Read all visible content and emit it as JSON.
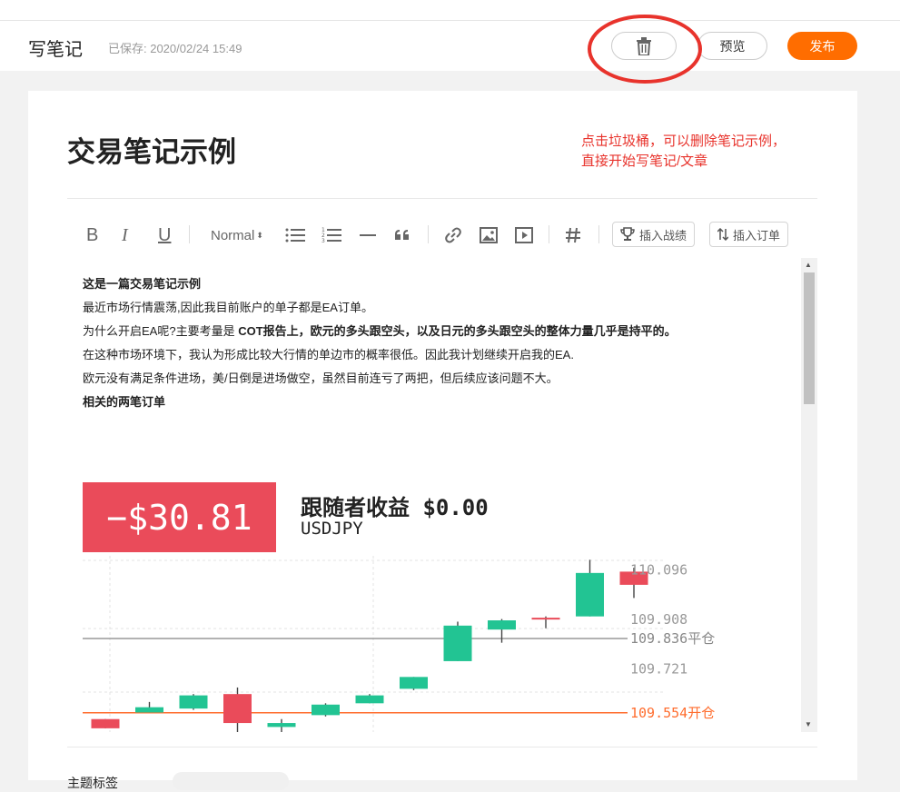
{
  "header": {
    "title": "写笔记",
    "saved_status": "已保存: 2020/02/24 15:49",
    "preview_label": "预览",
    "publish_label": "发布"
  },
  "note": {
    "title": "交易笔记示例",
    "annotation_line1": "点击垃圾桶，可以删除笔记示例，",
    "annotation_line2": "直接开始写笔记/文章"
  },
  "toolbar": {
    "bold": "B",
    "italic": "I",
    "underline": "U",
    "heading_select": "Normal",
    "insert_record_label": "插入战绩",
    "insert_order_label": "插入订单"
  },
  "content": {
    "p1": "这是一篇交易笔记示例",
    "p2": "最近市场行情震荡,因此我目前账户的单子都是EA订单。",
    "p3_prefix": "为什么开启EA呢?主要考量是 ",
    "p3_bold": "COT报告上，欧元的多头跟空头，以及日元的多头跟空头的整体力量几乎是持平的。",
    "p4": "在这种市场环境下，我认为形成比较大行情的单边市的概率很低。因此我计划继续开启我的EA.",
    "p5": "欧元没有满足条件进场，美/日倒是进场做空，虽然目前连亏了两把，但后续应该问题不大。",
    "p6": "相关的两笔订单"
  },
  "trade_card": {
    "pnl": "−$30.81",
    "follower_profit": "跟随者收益 $0.00",
    "symbol": "USDJPY"
  },
  "chart_data": {
    "type": "candlestick",
    "price_labels": [
      "110.096",
      "109.908",
      "109.836平仓",
      "109.721",
      "109.554开仓"
    ],
    "close_level": 109.836,
    "open_level": 109.554,
    "close_label": "109.836平仓",
    "open_label": "109.554开仓",
    "candles": [
      {
        "o": 109.53,
        "c": 109.495,
        "h": 109.53,
        "l": 109.495
      },
      {
        "o": 109.555,
        "c": 109.575,
        "h": 109.595,
        "l": 109.555
      },
      {
        "o": 109.57,
        "c": 109.62,
        "h": 109.625,
        "l": 109.565
      },
      {
        "o": 109.625,
        "c": 109.515,
        "h": 109.65,
        "l": 109.465
      },
      {
        "o": 109.5,
        "c": 109.515,
        "h": 109.53,
        "l": 109.475
      },
      {
        "o": 109.545,
        "c": 109.585,
        "h": 109.59,
        "l": 109.54
      },
      {
        "o": 109.59,
        "c": 109.62,
        "h": 109.625,
        "l": 109.59
      },
      {
        "o": 109.645,
        "c": 109.69,
        "h": 109.69,
        "l": 109.64
      },
      {
        "o": 109.75,
        "c": 109.885,
        "h": 109.9,
        "l": 109.75
      },
      {
        "o": 109.87,
        "c": 109.905,
        "h": 109.91,
        "l": 109.82
      },
      {
        "o": 109.915,
        "c": 109.91,
        "h": 109.92,
        "l": 109.875
      },
      {
        "o": 109.92,
        "c": 110.085,
        "h": 110.135,
        "l": 109.92
      },
      {
        "o": 110.09,
        "c": 110.04,
        "h": 110.105,
        "l": 109.99
      }
    ],
    "up_color": "#22c493",
    "down_color": "#ea4b5a"
  },
  "footer": {
    "label": "主题标签"
  }
}
